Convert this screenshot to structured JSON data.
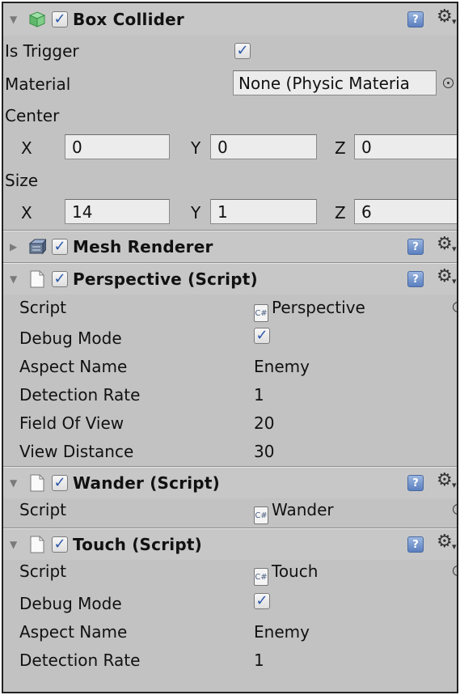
{
  "box_collider": {
    "title": "Box Collider",
    "is_trigger_label": "Is Trigger",
    "material_label": "Material",
    "material_value": "None (Physic Materia",
    "center_label": "Center",
    "center": {
      "x_label": "X",
      "x": "0",
      "y_label": "Y",
      "y": "0",
      "z_label": "Z",
      "z": "0"
    },
    "size_label": "Size",
    "size": {
      "x_label": "X",
      "x": "14",
      "y_label": "Y",
      "y": "1",
      "z_label": "Z",
      "z": "6"
    }
  },
  "mesh_renderer": {
    "title": "Mesh Renderer"
  },
  "perspective": {
    "title": "Perspective (Script)",
    "script_label": "Script",
    "script_value": "Perspective",
    "debug_mode_label": "Debug Mode",
    "aspect_name_label": "Aspect Name",
    "aspect_name_value": "Enemy",
    "detection_rate_label": "Detection Rate",
    "detection_rate_value": "1",
    "field_of_view_label": "Field Of View",
    "field_of_view_value": "20",
    "view_distance_label": "View Distance",
    "view_distance_value": "30"
  },
  "wander": {
    "title": "Wander (Script)",
    "script_label": "Script",
    "script_value": "Wander"
  },
  "touch": {
    "title": "Touch (Script)",
    "script_label": "Script",
    "script_value": "Touch",
    "debug_mode_label": "Debug Mode",
    "aspect_name_label": "Aspect Name",
    "aspect_name_value": "Enemy",
    "detection_rate_label": "Detection Rate",
    "detection_rate_value": "1"
  },
  "icons": {
    "foldout_open": "triangle-down-icon",
    "foldout_closed": "triangle-right-icon",
    "collider": "cube-icon",
    "mesh": "mesh-renderer-icon",
    "script": "document-icon",
    "help": "help-icon",
    "settings": "gear-icon",
    "object_picker": "object-picker-icon",
    "checkmark": "checkmark-icon"
  },
  "colors": {
    "panel_background": "#c2c2c2",
    "field_background": "#ececec",
    "checkmark": "#2b57a8",
    "collider_icon": "#5fb86b"
  }
}
